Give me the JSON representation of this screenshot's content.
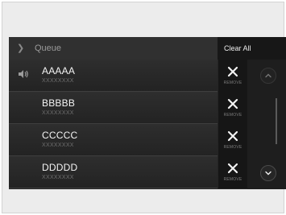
{
  "header": {
    "title": "Queue",
    "clear_label": "Clear All"
  },
  "queue": [
    {
      "title": "AAAAA",
      "subtitle": "XXXXXXXX",
      "remove_label": "REMOVE",
      "now_playing": true
    },
    {
      "title": "BBBBB",
      "subtitle": "XXXXXXXX",
      "remove_label": "REMOVE",
      "now_playing": false
    },
    {
      "title": "CCCCC",
      "subtitle": "XXXXXXXX",
      "remove_label": "REMOVE",
      "now_playing": false
    },
    {
      "title": "DDDDD",
      "subtitle": "XXXXXXXX",
      "remove_label": "REMOVE",
      "now_playing": false
    }
  ],
  "icons": {
    "back": "chevron-right-icon",
    "now_playing": "speaker-icon",
    "remove": "close-icon",
    "scroll_up": "chevron-up-icon",
    "scroll_down": "chevron-down-icon"
  },
  "colors": {
    "screen_bg": "#252525",
    "header_bg": "#303030",
    "button_bg": "#161616",
    "text_primary": "#f4f4f4",
    "text_secondary": "#6f6f6f"
  }
}
